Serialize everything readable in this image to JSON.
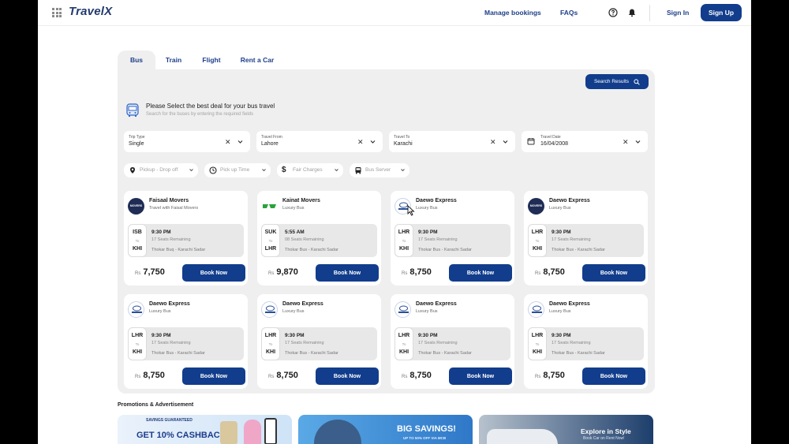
{
  "header": {
    "logo": "TravelX",
    "nav": {
      "manage_bookings": "Manage bookings",
      "faqs": "FAQs"
    },
    "sign_in": "Sign In",
    "sign_up": "Sign Up"
  },
  "tabs": [
    {
      "label": "Bus"
    },
    {
      "label": "Train"
    },
    {
      "label": "Flight"
    },
    {
      "label": "Rent a Car"
    }
  ],
  "search": {
    "button_label": "Search Results",
    "intro_title": "Please Select the best deal for your bus travel",
    "intro_sub": "Search for the buses by entering the required fields",
    "fields": [
      {
        "label": "Trip Type",
        "value": "Single"
      },
      {
        "label": "Travel From",
        "value": "Lahore"
      },
      {
        "label": "Travel To",
        "value": "Karachi"
      },
      {
        "label": "Travel Date",
        "value": "16/04/2008"
      }
    ],
    "filters": [
      {
        "label": "Pickup - Drop off"
      },
      {
        "label": "Pick up Time"
      },
      {
        "label": "Fair Charges"
      },
      {
        "label": "Bus Server"
      }
    ]
  },
  "cards": [
    {
      "operator": "Faisaal Movers",
      "subtitle": "Travel with Faisal Movers",
      "from": "ISB",
      "to_label": "To",
      "to": "KHI",
      "time": "9:30 PM",
      "seats": "17 Seats Remaining",
      "route": "Thokar Buq - Karachi Sadar",
      "currency": "Rs",
      "price": "7,750",
      "book": "Book Now"
    },
    {
      "operator": "Kainat Movers",
      "subtitle": "Luxury Bus",
      "from": "SUK",
      "to_label": "To",
      "to": "LHR",
      "time": "5:55 AM",
      "seats": "08 Seats Remaining",
      "route": "Thokar Bus - Karachi Sadar",
      "currency": "Rs",
      "price": "9,870",
      "book": "Book Now"
    },
    {
      "operator": "Daewo Express",
      "subtitle": "Luxury Bus",
      "from": "LHR",
      "to_label": "To",
      "to": "KHI",
      "time": "9:30 PM",
      "seats": "17 Seats Remaining",
      "route": "Thokar Bus - Karachi Sadar",
      "currency": "Rs",
      "price": "8,750",
      "book": "Book Now"
    },
    {
      "operator": "Daewo Express",
      "subtitle": "Luxury Bus",
      "from": "LHR",
      "to_label": "To",
      "to": "KHI",
      "time": "9:30 PM",
      "seats": "17 Seats Remaining",
      "route": "Thokar Bus - Karachi Sadar",
      "currency": "Rs",
      "price": "8,750",
      "book": "Book Now"
    },
    {
      "operator": "Daewo Express",
      "subtitle": "Luxury Bus",
      "from": "LHR",
      "to_label": "To",
      "to": "KHI",
      "time": "9:30 PM",
      "seats": "17 Seats Remaining",
      "route": "Thokar Bus - Karachi Sadar",
      "currency": "Rs",
      "price": "8,750",
      "book": "Book Now"
    },
    {
      "operator": "Daewo Express",
      "subtitle": "Luxury Bus",
      "from": "LHR",
      "to_label": "To",
      "to": "KHI",
      "time": "9:30 PM",
      "seats": "17 Seats Remaining",
      "route": "Thokar Bus - Karachi Sadar",
      "currency": "Rs",
      "price": "8,750",
      "book": "Book Now"
    },
    {
      "operator": "Daewo Express",
      "subtitle": "Luxury Bus",
      "from": "LHR",
      "to_label": "To",
      "to": "KHI",
      "time": "9:30 PM",
      "seats": "17 Seats Remaining",
      "route": "Thokar Bus - Karachi Sadar",
      "currency": "Rs",
      "price": "8,750",
      "book": "Book Now"
    },
    {
      "operator": "Daewo Express",
      "subtitle": "Luxury Bus",
      "from": "LHR",
      "to_label": "To",
      "to": "KHI",
      "time": "9:30 PM",
      "seats": "17 Seats Remaining",
      "route": "Thokar Bus - Karachi Sadar",
      "currency": "Rs",
      "price": "8,750",
      "book": "Book Now"
    }
  ],
  "promotions": {
    "title": "Promotions & Advertisement",
    "items": [
      {
        "line1": "SAVINGS GUARANTEED",
        "line2": "GET 10% CASHBACK"
      },
      {
        "line1": "BIG SAVINGS!",
        "line2": "UP TO 50% OFF VIA MCB"
      },
      {
        "line1": "Explore in Style",
        "line2": "Book Car on Rent Now!"
      }
    ]
  },
  "colors": {
    "primary": "#123d8c",
    "panel": "#efefef",
    "accent_link": "#1e3f8a"
  }
}
